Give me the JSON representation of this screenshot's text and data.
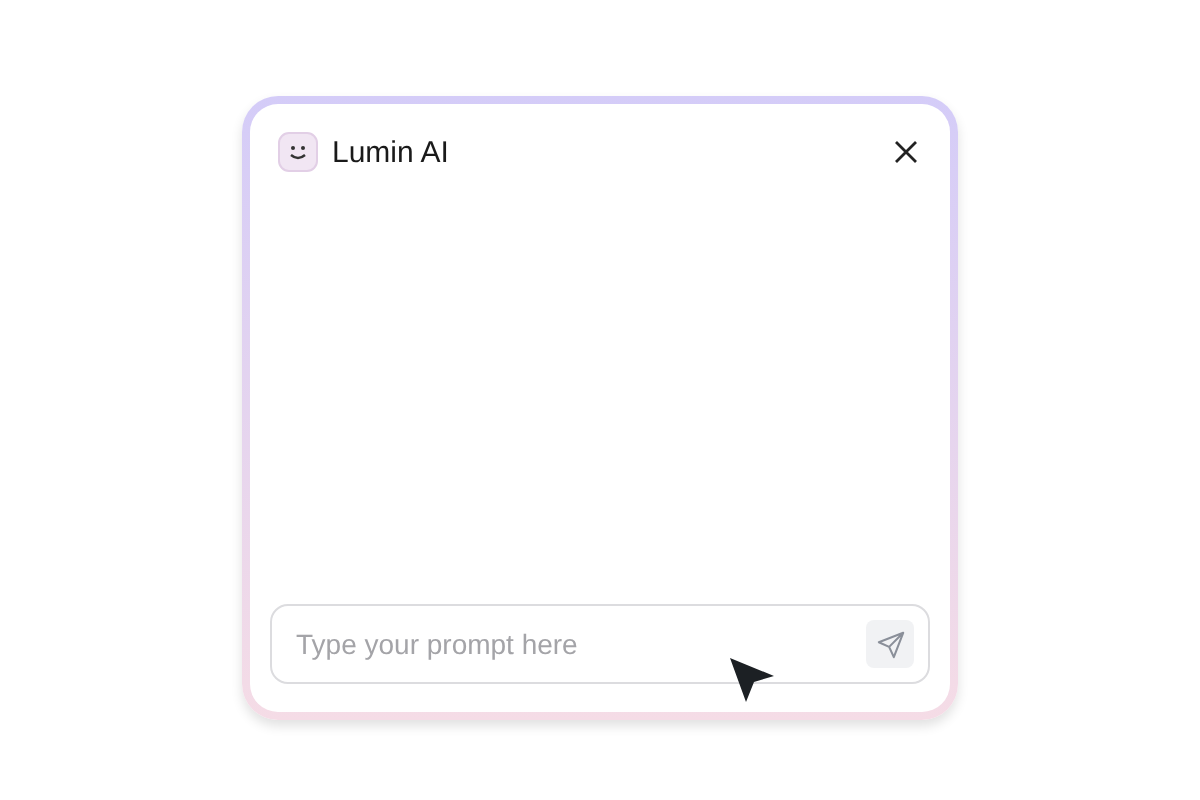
{
  "window": {
    "title": "Lumin AI"
  },
  "prompt": {
    "placeholder": "Type your prompt here"
  }
}
